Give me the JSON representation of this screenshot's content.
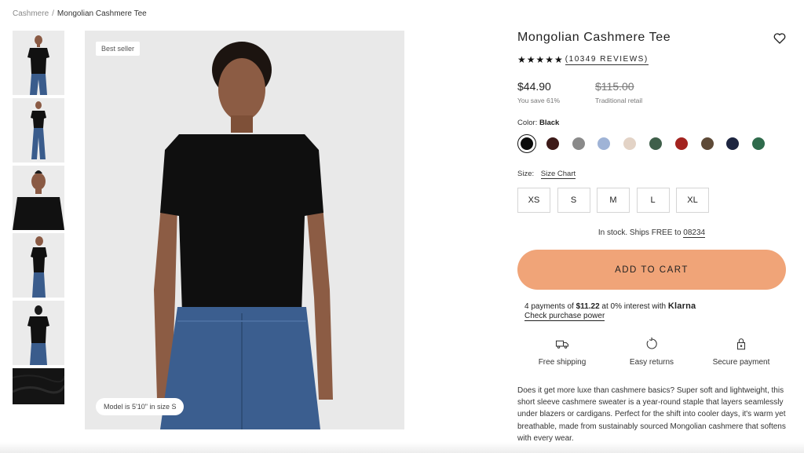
{
  "breadcrumb": {
    "parent": "Cashmere",
    "separator": "/",
    "current": "Mongolian Cashmere Tee"
  },
  "gallery": {
    "badge": "Best seller",
    "model_note": "Model is 5'10\" in size S",
    "thumbnails": [
      "front view",
      "full body",
      "close-up",
      "side view",
      "back view",
      "fabric detail"
    ]
  },
  "product": {
    "title": "Mongolian Cashmere Tee",
    "stars": "★★★★★",
    "reviews": "(10349 REVIEWS)",
    "price": "$44.90",
    "savings": "You save 61%",
    "original_price": "$115.00",
    "original_label": "Traditional retail",
    "color_label": "Color:",
    "color_selected": "Black",
    "swatches": [
      "#0b0b0b",
      "#3d1a18",
      "#8a8a8a",
      "#9fb3d6",
      "#e3d3c6",
      "#3f5f4a",
      "#a3231f",
      "#5e4a37",
      "#1d2540",
      "#2f6b4c"
    ],
    "size_label": "Size:",
    "size_chart": "Size Chart",
    "sizes": [
      "XS",
      "S",
      "M",
      "L",
      "XL"
    ],
    "stock_text": "In stock. Ships FREE to ",
    "zip": "08234",
    "add_to_cart": "ADD TO CART",
    "klarna": {
      "prefix": "4 payments of ",
      "amount": "$11.22",
      "suffix": " at 0% interest with ",
      "brand": "Klarna",
      "link": "Check purchase power"
    },
    "perks": [
      {
        "icon": "truck-icon",
        "label": "Free shipping"
      },
      {
        "icon": "returns-icon",
        "label": "Easy returns"
      },
      {
        "icon": "lock-icon",
        "label": "Secure payment"
      }
    ],
    "description": "Does it get more luxe than cashmere basics? Super soft and lightweight, this short sleeve cashmere sweater is a year-round staple that layers seamlessly under blazers or cardigans. Perfect for the shift into cooler days, it's warm yet breathable, made from sustainably sourced Mongolian cashmere that softens with every wear."
  },
  "colors": {
    "accent": "#f0a478",
    "text": "#222222"
  }
}
